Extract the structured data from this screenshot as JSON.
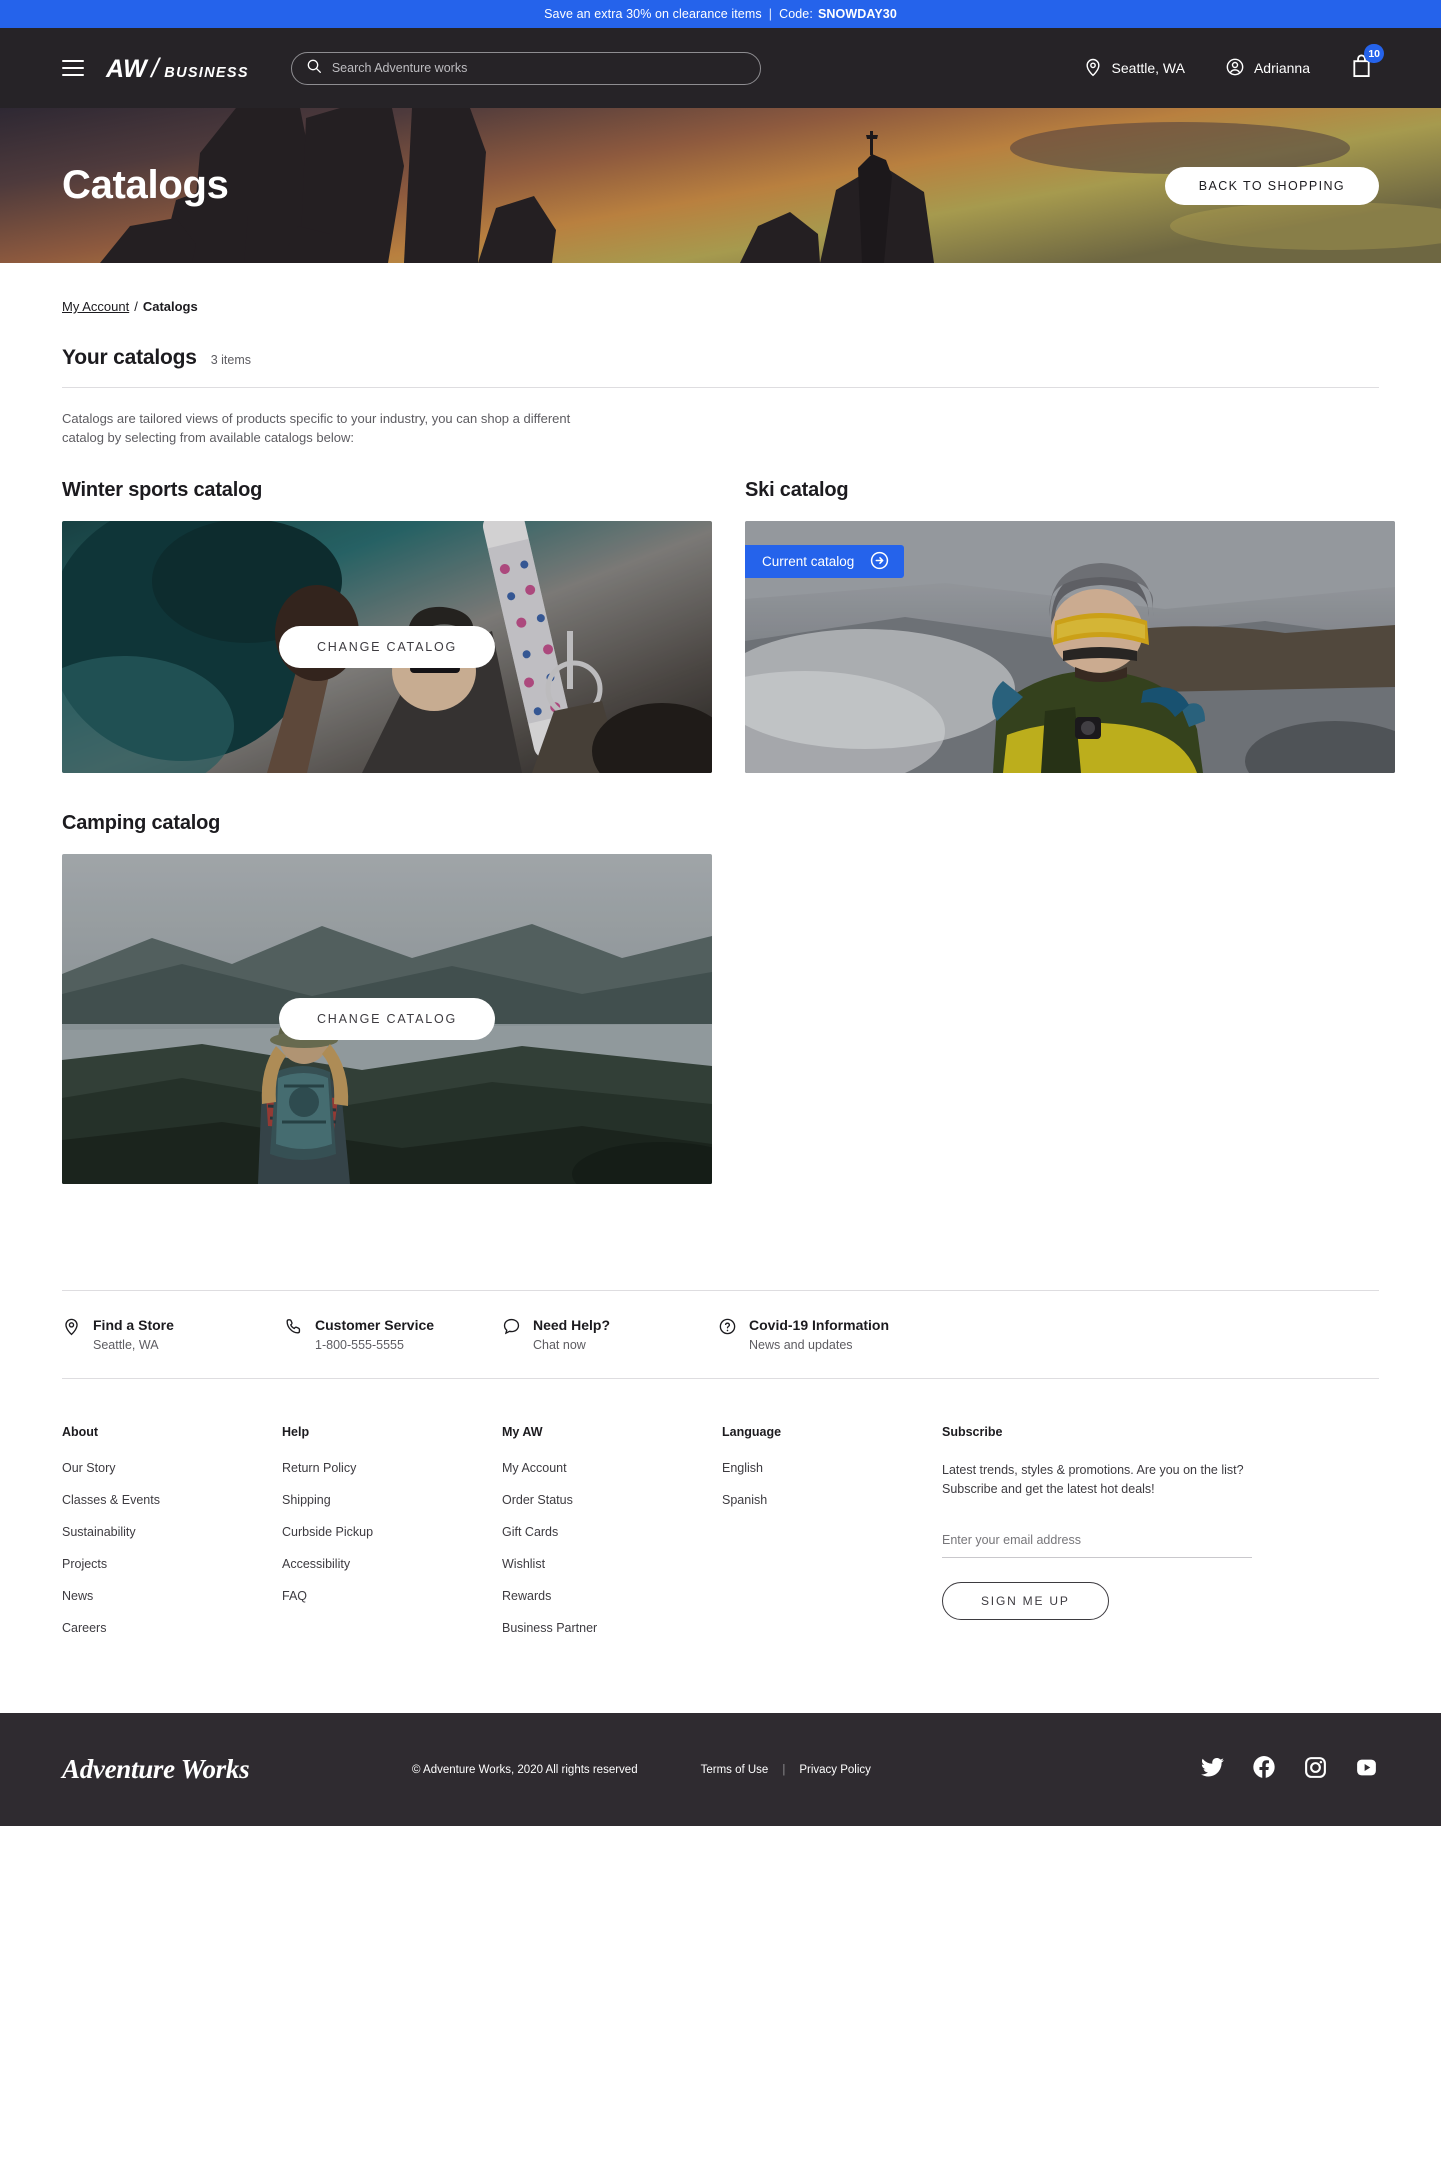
{
  "promo": {
    "text": "Save an extra 30% on clearance items",
    "separator": "|",
    "code_label": "Code:",
    "code": "SNOWDAY30",
    "bg_color": "#2563eb"
  },
  "header": {
    "brand_aw": "AW",
    "brand_slash": "/",
    "brand_business": "BUSINESS",
    "search_placeholder": "Search Adventure works",
    "search_value": "",
    "location": "Seattle, WA",
    "account": "Adrianna",
    "cart_count": "10",
    "bg_color": "#262327"
  },
  "hero": {
    "title": "Catalogs",
    "back_button": "BACK TO SHOPPING"
  },
  "breadcrumb": {
    "parent": "My Account",
    "separator": "/",
    "current": "Catalogs"
  },
  "section": {
    "title": "Your catalogs",
    "count": "3 items",
    "intro": "Catalogs are tailored views of products specific to your industry, you can shop a different catalog by selecting from available catalogs below:"
  },
  "catalogs": [
    {
      "title": "Winter sports catalog",
      "button": "CHANGE CATALOG",
      "is_current": false
    },
    {
      "title": "Ski catalog",
      "badge": "Current catalog",
      "is_current": true
    },
    {
      "title": "Camping catalog",
      "button": "CHANGE CATALOG",
      "is_current": false
    }
  ],
  "services": [
    {
      "icon": "location-pin-icon",
      "title": "Find a Store",
      "sub": "Seattle, WA"
    },
    {
      "icon": "phone-icon",
      "title": "Customer Service",
      "sub": "1-800-555-5555"
    },
    {
      "icon": "chat-bubble-icon",
      "title": "Need Help?",
      "sub": "Chat now"
    },
    {
      "icon": "question-circle-icon",
      "title": "Covid-19 Information",
      "sub": "News and updates"
    }
  ],
  "footer_columns": [
    {
      "heading": "About",
      "links": [
        "Our Story",
        "Classes & Events",
        "Sustainability",
        "Projects",
        "News",
        "Careers"
      ]
    },
    {
      "heading": "Help",
      "links": [
        "Return Policy",
        "Shipping",
        "Curbside Pickup",
        "Accessibility",
        "FAQ"
      ]
    },
    {
      "heading": "My AW",
      "links": [
        "My Account",
        "Order Status",
        "Gift Cards",
        "Wishlist",
        "Rewards",
        "Business Partner"
      ]
    },
    {
      "heading": "Language",
      "links": [
        "English",
        "Spanish"
      ]
    }
  ],
  "subscribe": {
    "heading": "Subscribe",
    "desc_line1": "Latest trends, styles & promotions. Are you on the list?",
    "desc_line2": "Subscribe and get the latest hot deals!",
    "email_placeholder": "Enter your email address",
    "email_value": "",
    "button": "SIGN ME UP"
  },
  "bottom": {
    "logo": "Adventure Works",
    "copyright": "© Adventure Works, 2020 All rights reserved",
    "terms": "Terms of Use",
    "privacy": "Privacy Policy",
    "social": [
      "twitter-icon",
      "facebook-icon",
      "instagram-icon",
      "youtube-icon"
    ]
  }
}
